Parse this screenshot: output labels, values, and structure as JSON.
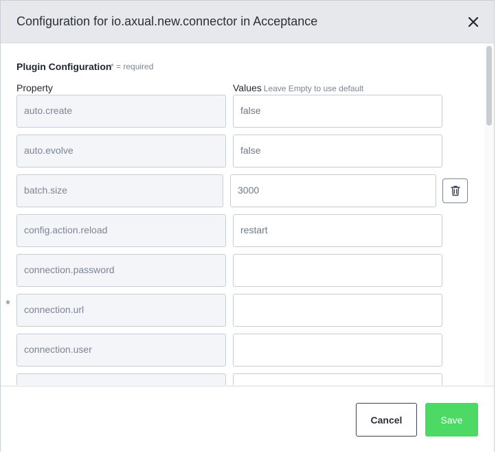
{
  "dialog": {
    "title": "Configuration for io.axual.new.connector in Acceptance",
    "close_icon": "close-icon"
  },
  "section": {
    "title": "Plugin Configuration",
    "required_note": "* = required"
  },
  "columns": {
    "property": "Property",
    "values": "Values",
    "values_hint": "Leave Empty to use default"
  },
  "rows": [
    {
      "property": "auto.create",
      "value": "false",
      "required": false
    },
    {
      "property": "auto.evolve",
      "value": "false",
      "required": false
    },
    {
      "property": "batch.size",
      "value": "3000",
      "required": false,
      "editable_delete": true
    },
    {
      "property": "config.action.reload",
      "value": "restart",
      "required": false
    },
    {
      "property": "connection.password",
      "value": "",
      "required": false
    },
    {
      "property": "connection.url",
      "value": "",
      "required": true
    },
    {
      "property": "connection.user",
      "value": "",
      "required": false
    },
    {
      "property": "",
      "value": "",
      "required": false
    }
  ],
  "required_mark": "*",
  "footer": {
    "cancel_label": "Cancel",
    "save_label": "Save"
  },
  "colors": {
    "header_bg": "#e6e8ec",
    "save_green": "#4cd964",
    "field_bg": "#f4f5f8",
    "border": "#c7cdd6"
  }
}
